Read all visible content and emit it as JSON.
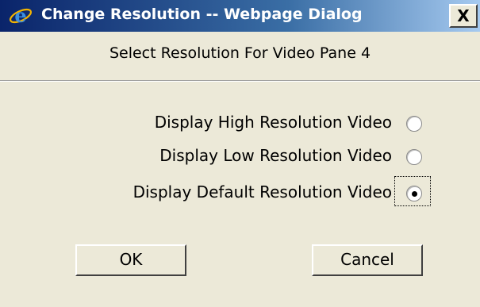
{
  "window": {
    "title": "Change Resolution -- Webpage Dialog",
    "title_icon": "ie-icon",
    "close_label": "X"
  },
  "header": {
    "label": "Select Resolution For Video Pane 4"
  },
  "options": [
    {
      "label": "Display High Resolution Video",
      "selected": false
    },
    {
      "label": "Display Low Resolution Video",
      "selected": false
    },
    {
      "label": "Display Default Resolution Video",
      "selected": true
    }
  ],
  "buttons": {
    "ok_label": "OK",
    "cancel_label": "Cancel"
  },
  "colors": {
    "titlebar_start": "#0a246a",
    "titlebar_end": "#a6caf0",
    "dialog_bg": "#ece9d8"
  }
}
